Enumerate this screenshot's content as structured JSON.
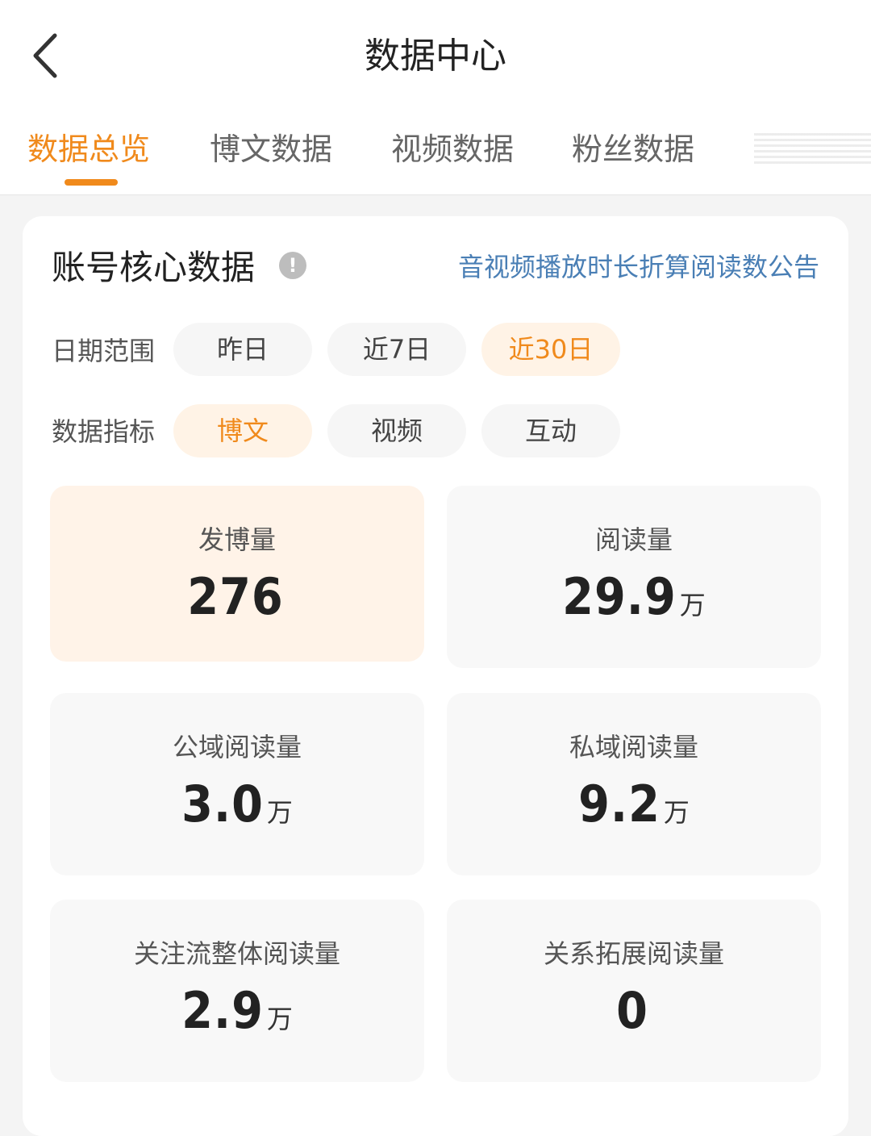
{
  "header": {
    "title": "数据中心"
  },
  "tabs": [
    {
      "label": "数据总览",
      "active": true
    },
    {
      "label": "博文数据",
      "active": false
    },
    {
      "label": "视频数据",
      "active": false
    },
    {
      "label": "粉丝数据",
      "active": false
    }
  ],
  "section": {
    "title": "账号核心数据",
    "notice_link": "音视频播放时长折算阅读数公告"
  },
  "date_range": {
    "label": "日期范围",
    "options": [
      "昨日",
      "近7日",
      "近30日"
    ],
    "selected": "近30日"
  },
  "metric_type": {
    "label": "数据指标",
    "options": [
      "博文",
      "视频",
      "互动"
    ],
    "selected": "博文"
  },
  "metrics": [
    {
      "label": "发博量",
      "value": "276",
      "unit": ""
    },
    {
      "label": "阅读量",
      "value": "29.9",
      "unit": "万"
    },
    {
      "label": "公域阅读量",
      "value": "3.0",
      "unit": "万"
    },
    {
      "label": "私域阅读量",
      "value": "9.2",
      "unit": "万"
    },
    {
      "label": "关注流整体阅读量",
      "value": "2.9",
      "unit": "万"
    },
    {
      "label": "关系拓展阅读量",
      "value": "0",
      "unit": ""
    }
  ],
  "colors": {
    "accent": "#f08a1c",
    "link": "#4a7fb5",
    "active_bg": "#fff3e8"
  }
}
